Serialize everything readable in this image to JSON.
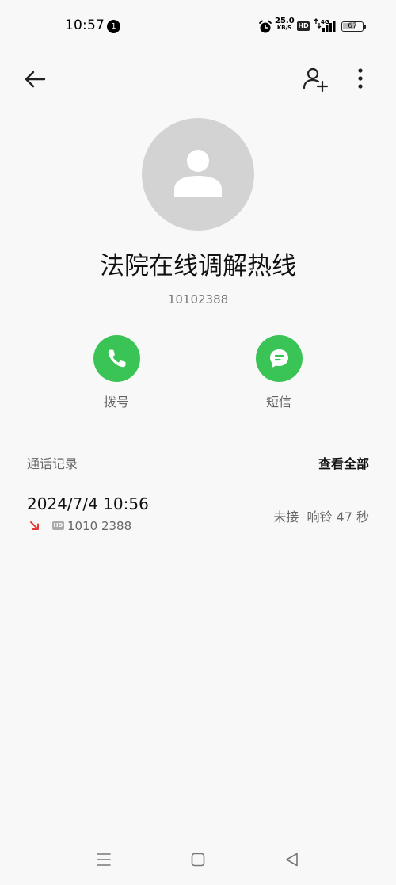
{
  "status_bar": {
    "time": "10:57",
    "notification_count": "1",
    "net_speed_value": "25.0",
    "net_speed_unit": "KB/S",
    "hd_label": "HD",
    "network_type": "4G",
    "battery_level": "67",
    "battery_fraction": 0.67
  },
  "header": {
    "back_icon": "arrow-left-icon",
    "add_contact_icon": "person-add-icon",
    "more_icon": "more-vertical-icon"
  },
  "contact": {
    "name": "法院在线调解热线",
    "number": "10102388",
    "avatar_icon": "person-placeholder-icon"
  },
  "actions": {
    "call_label": "拨号",
    "sms_label": "短信",
    "accent_color": "#3bc456"
  },
  "call_log": {
    "title": "通话记录",
    "view_all": "查看全部",
    "entries": [
      {
        "datetime": "2024/7/4 10:56",
        "type_icon": "missed-call-icon",
        "hd_label": "HD",
        "number": "1010 2388",
        "status": "未接  响铃 47 秒"
      }
    ]
  },
  "nav_bar": {
    "menu_icon": "menu-icon",
    "home_icon": "home-square-icon",
    "back_icon": "back-triangle-icon"
  }
}
